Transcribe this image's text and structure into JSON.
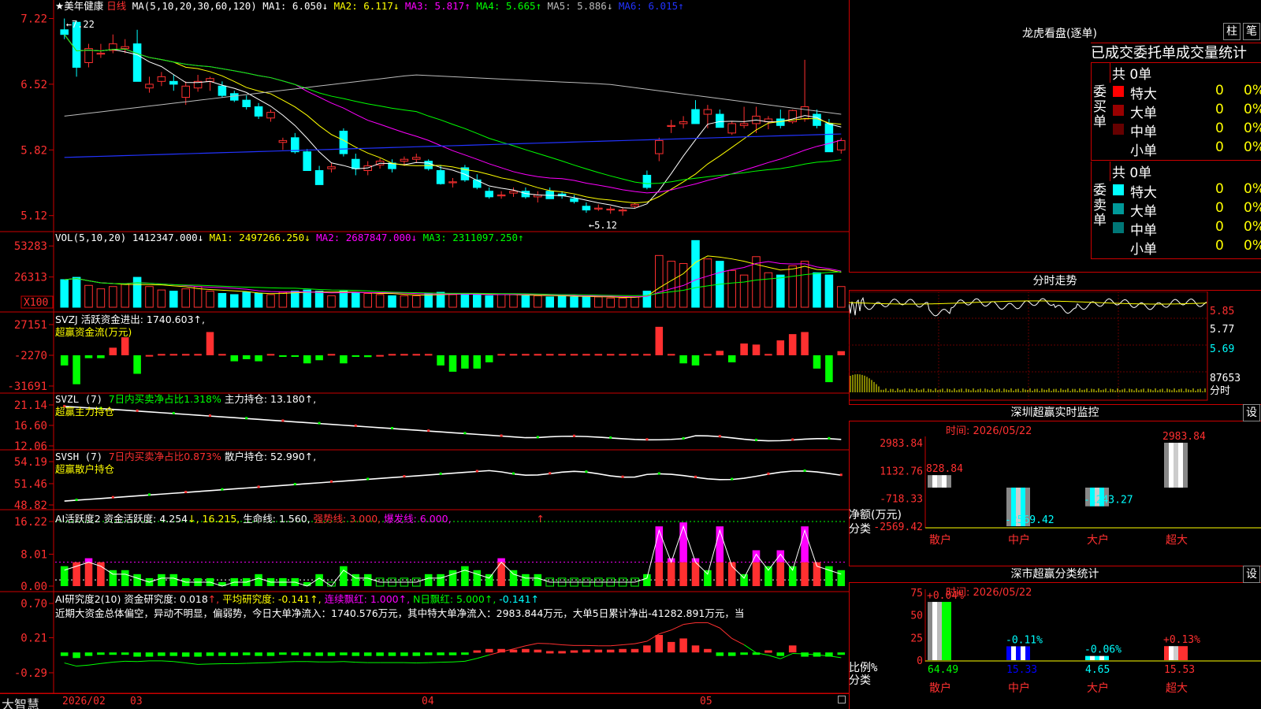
{
  "colors": {
    "up": "#ff3030",
    "down": "#00ffff",
    "bg": "#000000",
    "axis": "#cc0000",
    "white": "#ffffff",
    "yellow": "#ffff00",
    "magenta": "#ff00ff",
    "green": "#00ff00",
    "blue": "#2233ff",
    "gray": "#bbbbbb"
  },
  "kline": {
    "header_prefix": "★美年健康 ",
    "period": "日线",
    "ma_label": " MA(5,10,20,30,60,120) ",
    "mas": [
      {
        "t": "MA1: 6.050↓",
        "c": "#ffffff"
      },
      {
        "t": "MA2: 6.117↓",
        "c": "#ffff00"
      },
      {
        "t": "MA3: 5.817↑",
        "c": "#ff00ff"
      },
      {
        "t": "MA4: 5.665↑",
        "c": "#00ff00"
      },
      {
        "t": "MA5: 5.886↓",
        "c": "#bbbbbb"
      },
      {
        "t": "MA6: 6.015↑",
        "c": "#2233ff"
      }
    ],
    "yticks": [
      "7.22",
      "6.52",
      "5.82",
      "5.12"
    ],
    "high_note": "←7.22",
    "low_note": "←5.12",
    "ohlc": [
      [
        7.1,
        7.22,
        7.0,
        7.05
      ],
      [
        7.18,
        7.2,
        6.6,
        6.7
      ],
      [
        6.75,
        6.95,
        6.7,
        6.9
      ],
      [
        6.85,
        6.95,
        6.8,
        6.85
      ],
      [
        6.88,
        7.05,
        6.85,
        6.95
      ],
      [
        6.9,
        7.0,
        6.85,
        6.92
      ],
      [
        6.95,
        7.1,
        6.55,
        6.55
      ],
      [
        6.48,
        6.6,
        6.43,
        6.52
      ],
      [
        6.55,
        6.65,
        6.5,
        6.6
      ],
      [
        6.55,
        6.62,
        6.45,
        6.52
      ],
      [
        6.38,
        6.55,
        6.3,
        6.5
      ],
      [
        6.48,
        6.62,
        6.44,
        6.55
      ],
      [
        6.55,
        6.6,
        6.45,
        6.58
      ],
      [
        6.5,
        6.55,
        6.38,
        6.4
      ],
      [
        6.42,
        6.45,
        6.33,
        6.35
      ],
      [
        6.35,
        6.4,
        6.25,
        6.28
      ],
      [
        6.28,
        6.32,
        6.15,
        6.18
      ],
      [
        6.16,
        6.25,
        6.12,
        6.22
      ],
      [
        5.9,
        5.95,
        5.82,
        5.92
      ],
      [
        5.95,
        6.0,
        5.78,
        5.8
      ],
      [
        5.8,
        5.83,
        5.6,
        5.6
      ],
      [
        5.6,
        5.65,
        5.45,
        5.45
      ],
      [
        5.62,
        5.68,
        5.58,
        5.64
      ],
      [
        6.02,
        6.05,
        5.75,
        5.78
      ],
      [
        5.72,
        5.78,
        5.55,
        5.62
      ],
      [
        5.6,
        5.7,
        5.55,
        5.65
      ],
      [
        5.66,
        5.73,
        5.62,
        5.7
      ],
      [
        5.68,
        5.72,
        5.58,
        5.62
      ],
      [
        5.7,
        5.75,
        5.65,
        5.72
      ],
      [
        5.72,
        5.78,
        5.68,
        5.74
      ],
      [
        5.7,
        5.72,
        5.6,
        5.62
      ],
      [
        5.6,
        5.66,
        5.45,
        5.46
      ],
      [
        5.48,
        5.52,
        5.42,
        5.48
      ],
      [
        5.63,
        5.66,
        5.48,
        5.5
      ],
      [
        5.5,
        5.56,
        5.4,
        5.42
      ],
      [
        5.38,
        5.42,
        5.3,
        5.32
      ],
      [
        5.34,
        5.38,
        5.3,
        5.34
      ],
      [
        5.36,
        5.42,
        5.32,
        5.38
      ],
      [
        5.38,
        5.42,
        5.3,
        5.32
      ],
      [
        5.32,
        5.38,
        5.26,
        5.34
      ],
      [
        5.38,
        5.42,
        5.3,
        5.3
      ],
      [
        5.35,
        5.38,
        5.3,
        5.33
      ],
      [
        5.3,
        5.34,
        5.25,
        5.27
      ],
      [
        5.22,
        5.26,
        5.15,
        5.18
      ],
      [
        5.2,
        5.24,
        5.17,
        5.2
      ],
      [
        5.18,
        5.22,
        5.14,
        5.19
      ],
      [
        5.17,
        5.2,
        5.12,
        5.18
      ],
      [
        5.22,
        5.26,
        5.2,
        5.24
      ],
      [
        5.55,
        5.6,
        5.4,
        5.42
      ],
      [
        5.78,
        5.95,
        5.7,
        5.92
      ],
      [
        6.08,
        6.14,
        6.0,
        6.08
      ],
      [
        6.1,
        6.18,
        6.05,
        6.12
      ],
      [
        6.25,
        6.35,
        6.1,
        6.1
      ],
      [
        6.2,
        6.3,
        6.05,
        6.25
      ],
      [
        6.2,
        6.25,
        6.08,
        6.06
      ],
      [
        6.0,
        6.12,
        5.98,
        6.1
      ],
      [
        6.08,
        6.28,
        6.05,
        6.1
      ],
      [
        6.1,
        6.28,
        6.0,
        6.18
      ],
      [
        6.12,
        6.18,
        6.04,
        6.15
      ],
      [
        6.15,
        6.25,
        6.05,
        6.08
      ],
      [
        6.12,
        6.25,
        6.1,
        6.24
      ],
      [
        6.15,
        6.78,
        6.12,
        6.28
      ],
      [
        6.2,
        6.25,
        6.05,
        6.08
      ],
      [
        6.1,
        6.15,
        5.8,
        5.8
      ],
      [
        5.82,
        5.95,
        5.78,
        5.92
      ]
    ]
  },
  "vol": {
    "label": "VOL(5,10,20) ",
    "vol": "1412347.000↓",
    "mas": [
      {
        "t": "MA1: 2497266.250↓",
        "c": "#ffff00"
      },
      {
        "t": "MA2: 2687847.000↓",
        "c": "#ff00ff"
      },
      {
        "t": "MA3: 2311097.250↑",
        "c": "#00ff00"
      }
    ],
    "yticks": [
      "53283",
      "26313"
    ],
    "unit": "X100"
  },
  "svzj": {
    "label": "SVZJ  活跃资金进出: 1740.603↑,",
    "sub": "超赢资金流(万元)",
    "yticks": [
      "27151",
      "-2270",
      "-31691"
    ]
  },
  "svzl": {
    "label": "SVZL (7) ",
    "p1": "7日内买卖净占比1.318%",
    "p2": " 主力持仓: 13.180↑,",
    "sub": "超赢主力持仓",
    "yticks": [
      "21.14",
      "16.60",
      "12.06"
    ]
  },
  "svsh": {
    "label": "SVSH (7) ",
    "p1": "7日内买卖净占比0.873%",
    "p2": " 散户持仓: 52.990↑,",
    "sub": "超赢散户持仓",
    "yticks": [
      "54.19",
      "51.46",
      "48.82"
    ]
  },
  "ai1": {
    "label": "AI活跃度2 资金活跃度: 4.254",
    "p1": "↓, 16.215,",
    "p2": " 生命线: 1.560,",
    "p3": " 强势线: 3.000,",
    "p4": " 爆发线: 6.000,",
    "arrow": "↑",
    "yticks": [
      "16.22",
      "8.01",
      "0.00"
    ]
  },
  "ai2": {
    "label": "AI研究度2(10) 资金研究度: 0.018",
    "p1": "↑,",
    "p2": " 平均研究度: -0.141↑,",
    "p3": " 连续飘红: 1.000↑,",
    "p4": " N日飘红: 5.000↑,",
    "p5": " -0.141↑",
    "text": "近期大资金总体偏空，异动不明显，偏弱势，今日大单净流入：1740.576万元，其中特大单净流入：2983.844万元，大单5日累计净出-41282.891万元，当",
    "yticks": [
      "0.70",
      "0.21",
      "-0.29"
    ]
  },
  "bottom": {
    "logo": "大智慧",
    "dates": [
      "2026/02",
      "03",
      "04",
      "05"
    ]
  },
  "lhkp": {
    "title": "龙虎看盘(逐单)",
    "btn_zhu": "柱",
    "btn_bi": "笔",
    "header": "已成交委托单成交量统计",
    "buy_label": "委买单",
    "sell_label": "委卖单",
    "buy_total": "共 0单",
    "sell_total": "共 0单",
    "buy_rows": [
      {
        "n": "特大",
        "v": "0",
        "p": "0%",
        "c": "#ff0000"
      },
      {
        "n": "大单",
        "v": "0",
        "p": "0%",
        "c": "#990000"
      },
      {
        "n": "中单",
        "v": "0",
        "p": "0%",
        "c": "#660000"
      },
      {
        "n": "小单",
        "v": "0",
        "p": "0%",
        "c": ""
      }
    ],
    "sell_rows": [
      {
        "n": "特大",
        "v": "0",
        "p": "0%",
        "c": "#00ffff"
      },
      {
        "n": "大单",
        "v": "0",
        "p": "0%",
        "c": "#009999"
      },
      {
        "n": "中单",
        "v": "0",
        "p": "0%",
        "c": "#007777"
      },
      {
        "n": "小单",
        "v": "0",
        "p": "0%",
        "c": ""
      }
    ]
  },
  "fenshi": {
    "title": "分时走势",
    "yticks": [
      "5.85",
      "5.77",
      "5.69"
    ],
    "vol": "87653",
    "vol_unit": "分时"
  },
  "szjk": {
    "title": "深圳超赢实时监控",
    "btn": "设",
    "time": "时间: 2026/05/22",
    "yticks": [
      "2983.84",
      "1132.76",
      "-718.33",
      "-2569.42"
    ],
    "ylabel": "净额(万元)",
    "xlabel": "分类",
    "bars": [
      {
        "cat": "散户",
        "val": 828.84,
        "label": "828.84"
      },
      {
        "cat": "中户",
        "val": -2569.42,
        "label": "-2569.42"
      },
      {
        "cat": "大户",
        "val": -1243.27,
        "label": "-1243.27"
      },
      {
        "cat": "超大",
        "val": 2983.84,
        "label": "2983.84"
      }
    ]
  },
  "scfl": {
    "title": "深市超赢分类统计",
    "btn": "设",
    "time": "时间: 2026/05/22",
    "yticks": [
      "75",
      "50",
      "25",
      "0"
    ],
    "ylabel": "比例%",
    "xlabel": "分类",
    "bars": [
      {
        "cat": "散户",
        "val": 64.49,
        "label": "64.49",
        "delta": "+0.04%"
      },
      {
        "cat": "中户",
        "val": 15.33,
        "label": "15.33",
        "delta": "-0.11%"
      },
      {
        "cat": "大户",
        "val": 4.65,
        "label": "4.65",
        "delta": "-0.06%"
      },
      {
        "cat": "超大",
        "val": 15.53,
        "label": "15.53",
        "delta": "+0.13%"
      }
    ]
  }
}
